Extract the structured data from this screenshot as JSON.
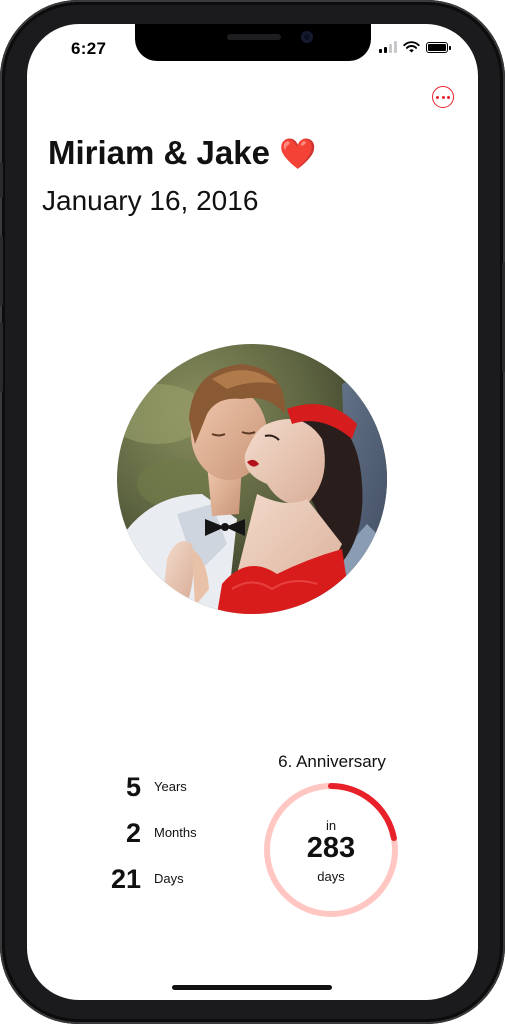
{
  "status_bar": {
    "time": "6:27"
  },
  "header": {
    "couple_names": "Miriam & Jake",
    "heart_emoji": "❤️",
    "start_date": "January 16, 2016",
    "more_icon": "ellipsis-circle-icon"
  },
  "photo": {
    "description_icon": "couple-photo"
  },
  "duration": [
    {
      "value": "5",
      "unit": "Years"
    },
    {
      "value": "2",
      "unit": "Months"
    },
    {
      "value": "21",
      "unit": "Days"
    }
  ],
  "anniversary": {
    "label": "6. Anniversary",
    "in_label": "in",
    "days_remaining": "283",
    "days_label": "days",
    "progress_fraction": 0.22
  },
  "colors": {
    "accent": "#e8202a",
    "ring_track": "#ffc6c2"
  }
}
